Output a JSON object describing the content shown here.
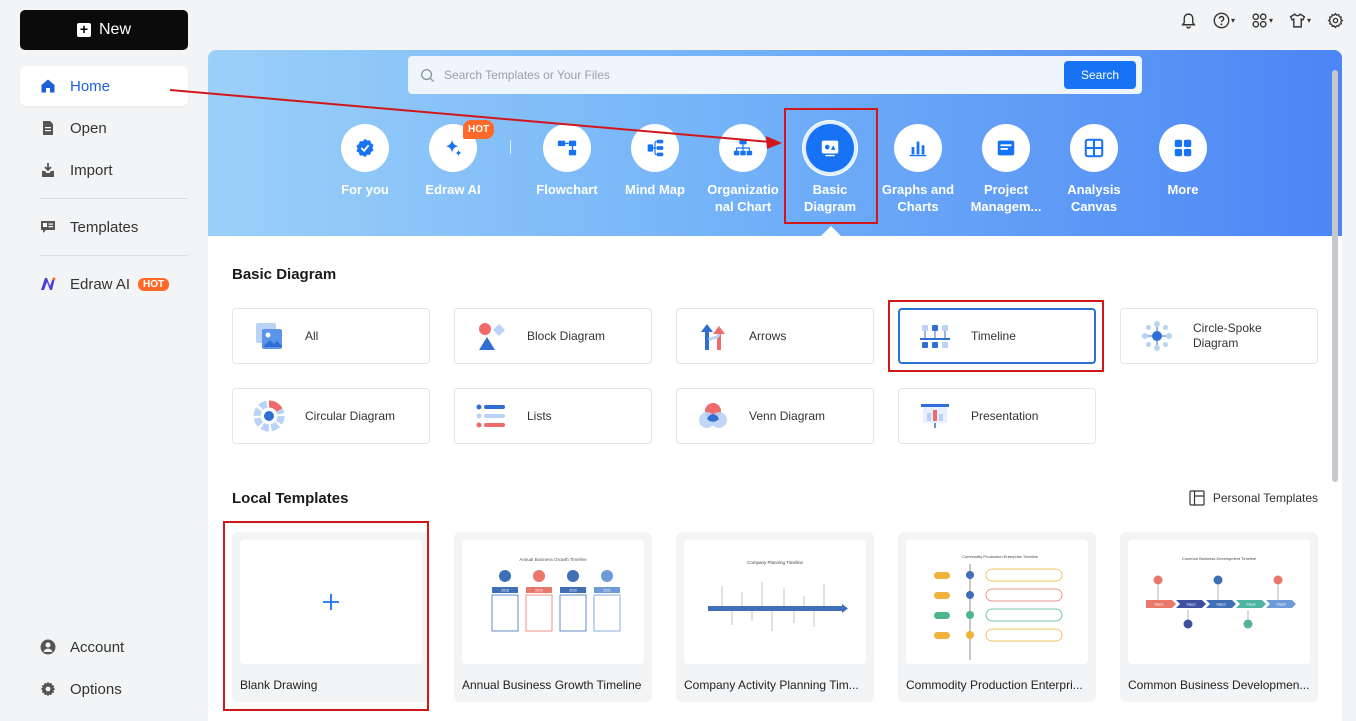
{
  "sidebar": {
    "new_label": "New",
    "items": [
      {
        "label": "Home"
      },
      {
        "label": "Open"
      },
      {
        "label": "Import"
      },
      {
        "label": "Templates"
      },
      {
        "label": "Edraw AI",
        "badge": "HOT"
      }
    ],
    "bottom": [
      {
        "label": "Account"
      },
      {
        "label": "Options"
      }
    ]
  },
  "search": {
    "placeholder": "Search Templates or Your Files",
    "button": "Search"
  },
  "categories": [
    {
      "label": "For you",
      "icon": "badge-check-icon"
    },
    {
      "label": "Edraw AI",
      "icon": "sparkle-icon",
      "badge": "HOT"
    },
    {
      "label": "Flowchart",
      "icon": "flowchart-icon"
    },
    {
      "label": "Mind Map",
      "icon": "mind-map-icon"
    },
    {
      "label_line1": "Organizatio",
      "label_line2": "nal Chart",
      "icon": "org-chart-icon"
    },
    {
      "label_line1": "Basic",
      "label_line2": "Diagram",
      "icon": "basic-diagram-icon",
      "selected": true
    },
    {
      "label_line1": "Graphs and",
      "label_line2": "Charts",
      "icon": "bar-chart-icon"
    },
    {
      "label_line1": "Project",
      "label_line2": "Managem...",
      "icon": "project-icon"
    },
    {
      "label_line1": "Analysis",
      "label_line2": "Canvas",
      "icon": "canvas-icon"
    },
    {
      "label": "More",
      "icon": "grid-icon"
    }
  ],
  "basic_section": {
    "title": "Basic Diagram",
    "tiles": [
      {
        "label": "All"
      },
      {
        "label": "Block Diagram"
      },
      {
        "label": "Arrows"
      },
      {
        "label": "Timeline",
        "selected": true
      },
      {
        "label_line1": "Circle-Spoke",
        "label_line2": "Diagram"
      },
      {
        "label": "Circular Diagram"
      },
      {
        "label": "Lists"
      },
      {
        "label": "Venn Diagram"
      },
      {
        "label": "Presentation"
      }
    ]
  },
  "local_section": {
    "title": "Local Templates",
    "personal_label": "Personal Templates",
    "cards": [
      {
        "caption": "Blank Drawing"
      },
      {
        "caption": "Annual Business Growth Timeline",
        "thumb_title": "Annual Business Growth Timeline",
        "years": [
          "2018",
          "2019",
          "2020",
          "2021"
        ]
      },
      {
        "caption": "Company Activity Planning Tim...",
        "thumb_title": "Company Planning Timeline"
      },
      {
        "caption": "Commodity Production Enterpri...",
        "thumb_title": "Commodity Production Enterprise Timeline"
      },
      {
        "caption": "Common Business Developmen...",
        "thumb_title": "Common Business Development Timeline",
        "steps": [
          "Step1",
          "Step2",
          "Step3",
          "Step4",
          "Step5"
        ]
      }
    ]
  },
  "colors": {
    "accent": "#1773f4",
    "annotation_red": "#d1171b",
    "hot": "#ff6a2a"
  }
}
